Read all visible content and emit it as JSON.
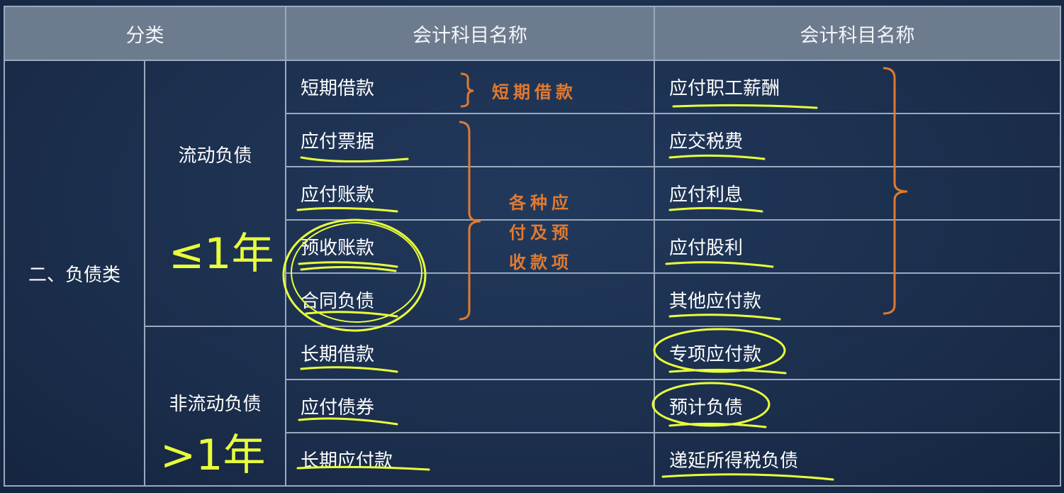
{
  "headers": [
    "分类",
    "会计科目名称",
    "会计科目名称"
  ],
  "category": "二、负债类",
  "sub_current": "流动负债",
  "sub_noncurrent": "非流动负债",
  "col1": [
    "短期借款",
    "应付票据",
    "应付账款",
    "预收账款",
    "合同负债",
    "长期借款",
    "应付债券",
    "长期应付款"
  ],
  "col2": [
    "应付职工薪酬",
    "应交税费",
    "应付利息",
    "应付股利",
    "其他应付款",
    "专项应付款",
    "预计负债",
    "递延所得税负债"
  ],
  "annotations": {
    "short_loan_note": "短期借款",
    "note_line1": "各种应",
    "note_line2": "付及预",
    "note_line3": "收款项",
    "le_one_year": "≤1年",
    "gt_one_year": ">1年"
  },
  "colors": {
    "background": "#1b2e4c",
    "header_bg": "#6c7b8e",
    "grid_line": "#9aa9bf",
    "annotation_orange": "#e07a30",
    "highlighter_yellow": "#e9ff3a"
  }
}
